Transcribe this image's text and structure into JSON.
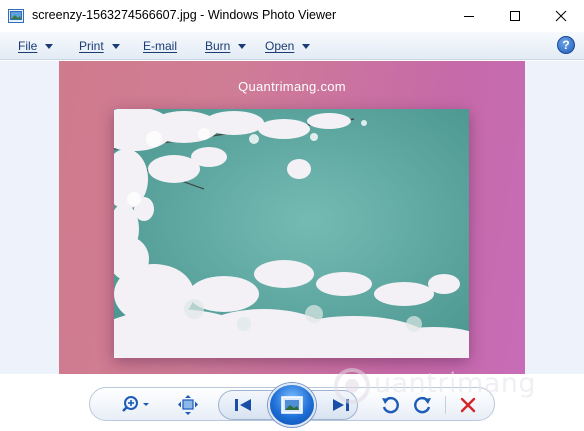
{
  "window": {
    "title": "screenzy-1563274566607.jpg - Windows Photo Viewer",
    "controls": [
      "minimize",
      "maximize",
      "close"
    ]
  },
  "menu": {
    "items": [
      {
        "label": "File",
        "has_dropdown": true
      },
      {
        "label": "Print",
        "has_dropdown": true
      },
      {
        "label": "E-mail",
        "has_dropdown": false
      },
      {
        "label": "Burn",
        "has_dropdown": true
      },
      {
        "label": "Open",
        "has_dropdown": true
      }
    ],
    "help_label": "?"
  },
  "image": {
    "overlay_text": "Quantrimang.com",
    "background_colors": [
      "#d07b8c",
      "#c76cb7"
    ],
    "photo_water_color": "#5aa7a0"
  },
  "toolbar": {
    "buttons": [
      "zoom-icon",
      "actual-size-icon",
      "previous-icon",
      "slideshow-icon",
      "next-icon",
      "rotate-counterclockwise-icon",
      "rotate-clockwise-icon",
      "delete-icon"
    ]
  },
  "watermark": {
    "text": "uantrimang"
  },
  "colors": {
    "accent": "#1d6fd6",
    "menu_text": "#1b3b73",
    "delete": "#d6252a"
  }
}
